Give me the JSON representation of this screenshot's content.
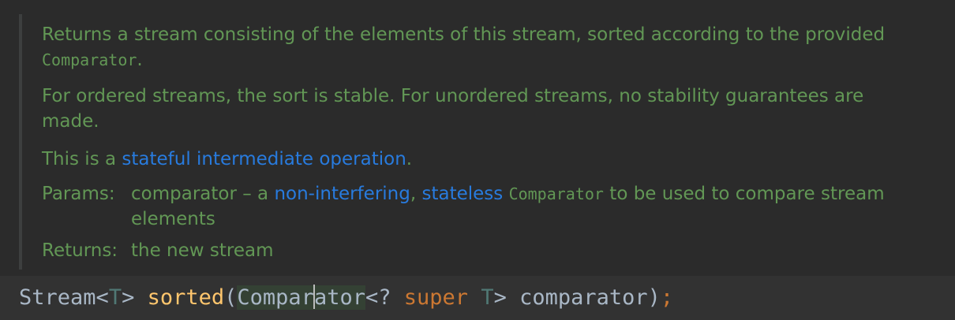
{
  "doc": {
    "summary_text": "Returns a stream consisting of the elements of this stream, sorted according to the provided",
    "summary_code": "Comparator",
    "summary_end": ".",
    "ordering_line1": "For ordered streams, the sort is stable. For unordered streams, no stability guarantees are",
    "ordering_line2": "made.",
    "stateful_prefix": "This is a ",
    "stateful_link": "stateful intermediate operation",
    "stateful_end": ".",
    "params_label": "Params:",
    "param_name": "comparator",
    "param_sep": " – a ",
    "param_link1": "non-interfering",
    "param_comma": ", ",
    "param_link2": "stateless",
    "param_space": " ",
    "param_code": "Comparator",
    "param_rest": " to be used to compare stream",
    "param_line2": "elements",
    "returns_label": "Returns:",
    "returns_text": "the new stream"
  },
  "code": {
    "stream": "Stream",
    "lt1": "<",
    "t1": "T",
    "gt1": "> ",
    "method": "sorted",
    "paren_open": "(",
    "comparator_a": "Compar",
    "comparator_b": "ator",
    "lt2": "<? ",
    "super_kw": "super",
    "space": " ",
    "t2": "T",
    "gt2": "> ",
    "arg": "comparator",
    "paren_close": ")",
    "semicolon": ";"
  },
  "colors": {
    "background": "#2b2b2b",
    "doc_text": "#629755",
    "doc_link": "#287bde",
    "code_text": "#a9b7c6",
    "type_param": "#507874",
    "method_name": "#ffc66d",
    "keyword": "#cc7832",
    "current_line": "#323232"
  }
}
